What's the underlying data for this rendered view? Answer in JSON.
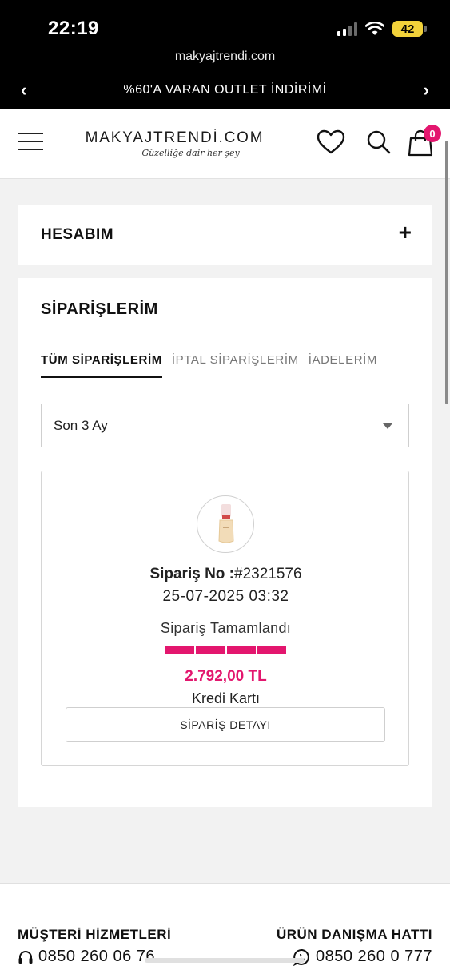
{
  "status_bar": {
    "time": "22:19",
    "battery": "42"
  },
  "browser": {
    "url": "makyajtrendi.com"
  },
  "promo": {
    "text": "%60'A VARAN OUTLET İNDİRİMİ"
  },
  "header": {
    "logo": "MAKYAJTRENDİ.COM",
    "tagline": "Güzelliğe dair her şey",
    "cart_count": "0",
    "icons": [
      "menu-icon",
      "heart-icon",
      "search-icon",
      "cart-icon"
    ]
  },
  "account": {
    "title": "HESABIM",
    "toggle": "+"
  },
  "orders": {
    "title": "SİPARİŞLERİM",
    "tabs": [
      "TÜM SİPARİŞLERİM",
      "İPTAL SİPARİŞLERİM",
      "İADELERİM"
    ],
    "filter": {
      "selected": "Son 3 Ay"
    },
    "order": {
      "no_label": "Sipariş No :",
      "no_value": "#2321576",
      "date": "25-07-2025 03:32",
      "status": "Sipariş Tamamlandı",
      "progress_steps_done": 4,
      "progress_steps_total": 4,
      "total": "2.792,00 TL",
      "payment": "Kredi Kartı",
      "detail_button": "SİPARİŞ DETAYI"
    }
  },
  "footer": {
    "customer_service": {
      "title": "MÜŞTERİ HİZMETLERİ",
      "phone": "0850 260 06 76"
    },
    "product_line": {
      "title": "ÜRÜN DANIŞMA HATTI",
      "phone": "0850 260 0 777"
    }
  },
  "colors": {
    "accent": "#e3166e",
    "promo_bg": "#000000",
    "page_bg": "#f2f2f2"
  }
}
